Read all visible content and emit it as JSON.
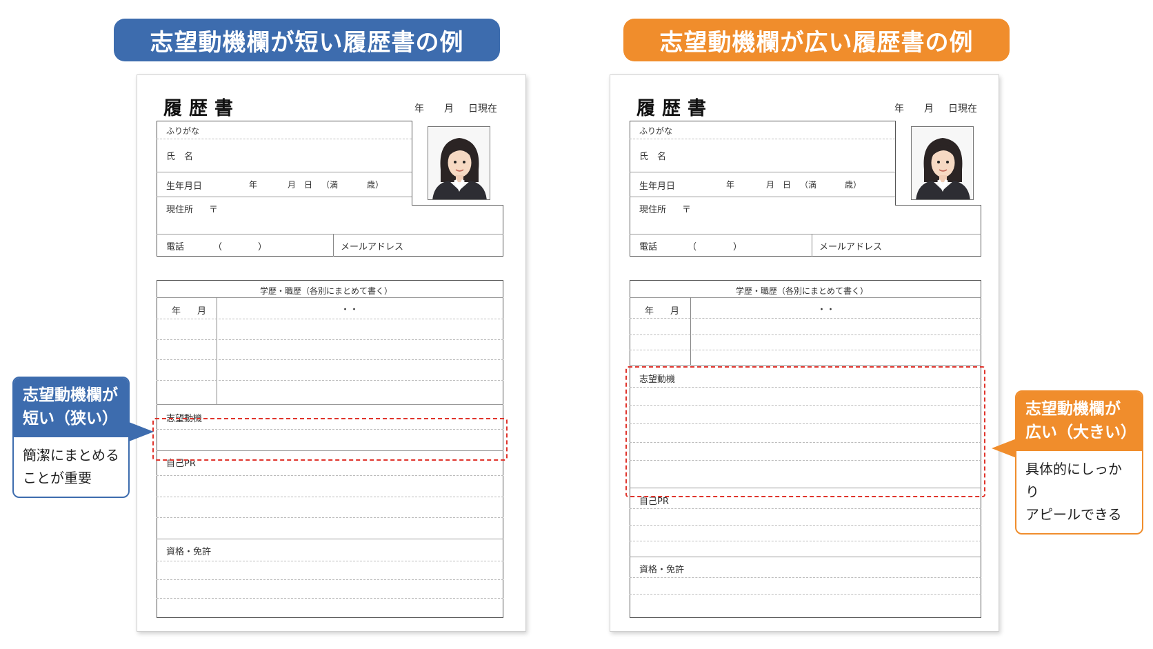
{
  "banners": {
    "left": "志望動機欄が短い履歴書の例",
    "right": "志望動機欄が広い履歴書の例"
  },
  "form": {
    "title": "履歴書",
    "date_year": "年",
    "date_month": "月",
    "date_day": "日現在",
    "furigana": "ふりがな",
    "name": "氏　名",
    "birth": "生年月日",
    "birth_year": "年",
    "birth_month_day": "月　日",
    "birth_age_open": "（満",
    "birth_age_close": "歳）",
    "address": "現住所",
    "postal_mark": "〒",
    "phone": "電話",
    "phone_paren_open": "（",
    "phone_paren_close": "）",
    "email": "メールアドレス",
    "history_header": "学歴・職歴（各別にまとめて書く）",
    "col_year": "年",
    "col_month": "月",
    "history_dots": "・・",
    "motivation": "志望動機",
    "self_pr": "自己PR",
    "licenses": "資格・免許"
  },
  "callouts": {
    "left": {
      "title_line1": "志望動機欄が",
      "title_line2": "短い（狭い）",
      "body_line1": "簡潔にまとめる",
      "body_line2": "ことが重要"
    },
    "right": {
      "title_line1": "志望動機欄が",
      "title_line2": "広い（大きい）",
      "body_line1": "具体的にしっかり",
      "body_line2": "アピールできる"
    }
  },
  "colors": {
    "left_accent": "#3d6cae",
    "right_accent": "#f08d2c",
    "highlight": "#e0342c"
  },
  "icons": {
    "photo": "person-photo-icon"
  }
}
